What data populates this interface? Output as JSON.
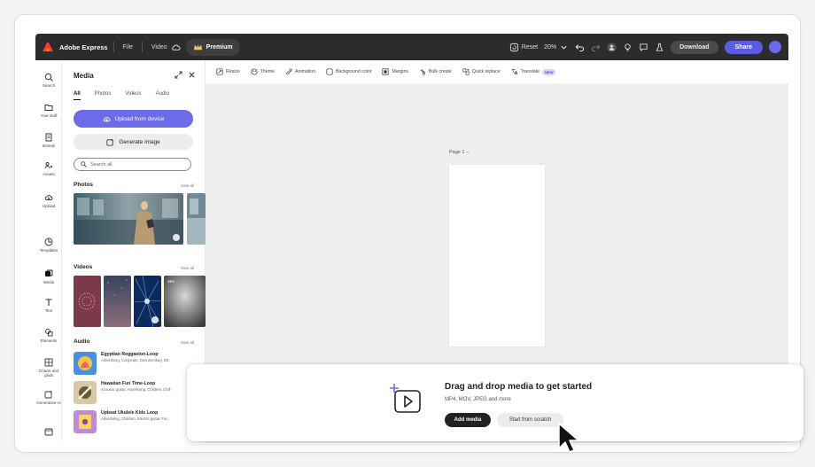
{
  "app": {
    "brand": "Adobe Express",
    "menu": [
      "File",
      "Video"
    ],
    "premium_label": "Premium",
    "reset_label": "Reset",
    "zoom": "20%",
    "download_label": "Download",
    "share_label": "Share"
  },
  "rail": [
    {
      "label": "Search",
      "icon": "search-icon"
    },
    {
      "label": "Your stuff",
      "icon": "folder-icon"
    },
    {
      "label": "Brands",
      "icon": "brand-icon"
    },
    {
      "label": "Assets",
      "icon": "people-icon"
    },
    {
      "label": "Upload",
      "icon": "upload-icon"
    },
    {
      "label": "Templates",
      "icon": "templates-icon"
    },
    {
      "label": "Media",
      "icon": "media-icon"
    },
    {
      "label": "Text",
      "icon": "text-icon"
    },
    {
      "label": "Elements",
      "icon": "elements-icon"
    },
    {
      "label": "Charts and grids",
      "icon": "grid-icon"
    },
    {
      "label": "Generative AI",
      "icon": "ai-icon"
    },
    {
      "label": "",
      "icon": "more-icon"
    }
  ],
  "panel": {
    "title": "Media",
    "tabs": [
      "All",
      "Photos",
      "Videos",
      "Audio"
    ],
    "upload_label": "Upload from device",
    "generate_label": "Generate image",
    "search_placeholder": "Search all",
    "photos_title": "Photos",
    "videos_title": "Videos",
    "audio_title": "Audio",
    "view_all": "View all",
    "video_badge": "4Ks",
    "audio": [
      {
        "name": "Egyptian Reggaeton-Loop",
        "tags": "Advertising, Corporate, Documentary, ED"
      },
      {
        "name": "Hawaiian Fun Time-Loop",
        "tags": "Acoustic guitar, Advertising, Children, Chill"
      },
      {
        "name": "Upbeat Ukulele Kids Loop",
        "tags": "Advertising, Children, Electric guitar, Fun"
      }
    ]
  },
  "quick_actions": [
    {
      "label": "Resize",
      "icon": "resize-icon"
    },
    {
      "label": "Theme",
      "icon": "theme-icon"
    },
    {
      "label": "Animation",
      "icon": "animation-icon"
    },
    {
      "label": "Background color",
      "icon": "background-color-icon"
    },
    {
      "label": "Margins",
      "icon": "margins-icon"
    },
    {
      "label": "Bulk create",
      "icon": "bulk-create-icon"
    },
    {
      "label": "Quick replace",
      "icon": "quick-replace-icon"
    },
    {
      "label": "Translate",
      "icon": "translate-icon",
      "badge": "NEW"
    }
  ],
  "canvas": {
    "page_label": "Page 1 –"
  },
  "drop": {
    "title": "Drag and drop media to get started",
    "subtitle": "MP4, MOV, JPEG and more",
    "add_label": "Add media",
    "scratch_label": "Start from scratch"
  },
  "colors": {
    "topbar": "#2c2c2c",
    "accent": "#6c6cea",
    "canvas": "#efefef"
  }
}
